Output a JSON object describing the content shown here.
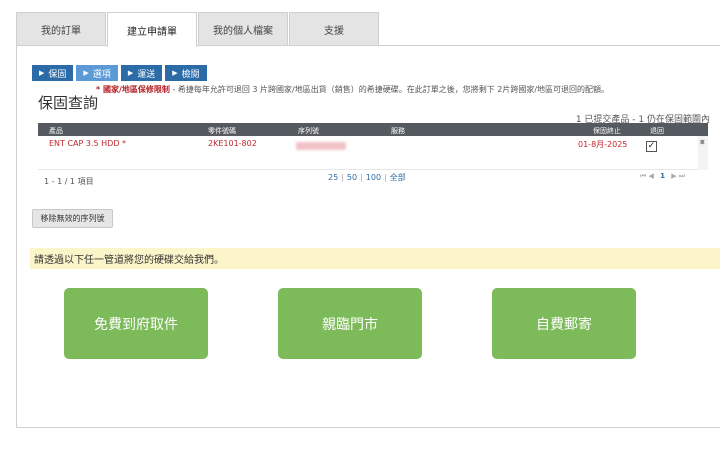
{
  "tabs": [
    {
      "label": "我的訂單"
    },
    {
      "label": "建立申請單"
    },
    {
      "label": "我的個人檔案"
    },
    {
      "label": "支援"
    }
  ],
  "steps": [
    {
      "label": "保固"
    },
    {
      "label": "選項"
    },
    {
      "label": "運送"
    },
    {
      "label": "檢閱"
    }
  ],
  "page_title": "保固查詢",
  "notice": {
    "highlight": "* 國家/地區保修限制",
    "text": " - 希捷每年允許可退回 3 片跨國家/地區出貨（銷售）的希捷硬碟。在此訂單之後，您將剩下 2片跨國家/地區可退回的配額。"
  },
  "summary": "1 已提交產品 - 1 仍在保固範圍內",
  "grid": {
    "headers": {
      "product": "產品",
      "part": "零件號碼",
      "serial": "序列號",
      "service": "服務",
      "warranty_end": "保固終止",
      "return": "退回"
    },
    "rows": [
      {
        "product": "ENT CAP 3.5 HDD *",
        "part": "2KE101-802",
        "service": "",
        "warranty_end": "01-8月-2025",
        "return_checked": "✓"
      }
    ]
  },
  "pager": {
    "items": "1 - 1 / 1 項目",
    "size_25": "25",
    "size_50": "50",
    "size_100": "100",
    "size_all": "全部",
    "first": "⏮",
    "prev": "◀",
    "current": "1",
    "next": "▶",
    "last": "⏭"
  },
  "remove_button": "移除無效的序列號",
  "banner": "請透過以下任一管道將您的硬碟交給我們。",
  "options": [
    {
      "label": "免費到府取件"
    },
    {
      "label": "親臨門市"
    },
    {
      "label": "自費郵寄"
    }
  ],
  "colors": {
    "step": "#2b6ca8",
    "step_current": "#5b9ad6",
    "option_green": "#7cba5a",
    "banner_bg": "#fbf5c9",
    "grid_header": "#555a60",
    "warning_red": "#b5242b"
  }
}
